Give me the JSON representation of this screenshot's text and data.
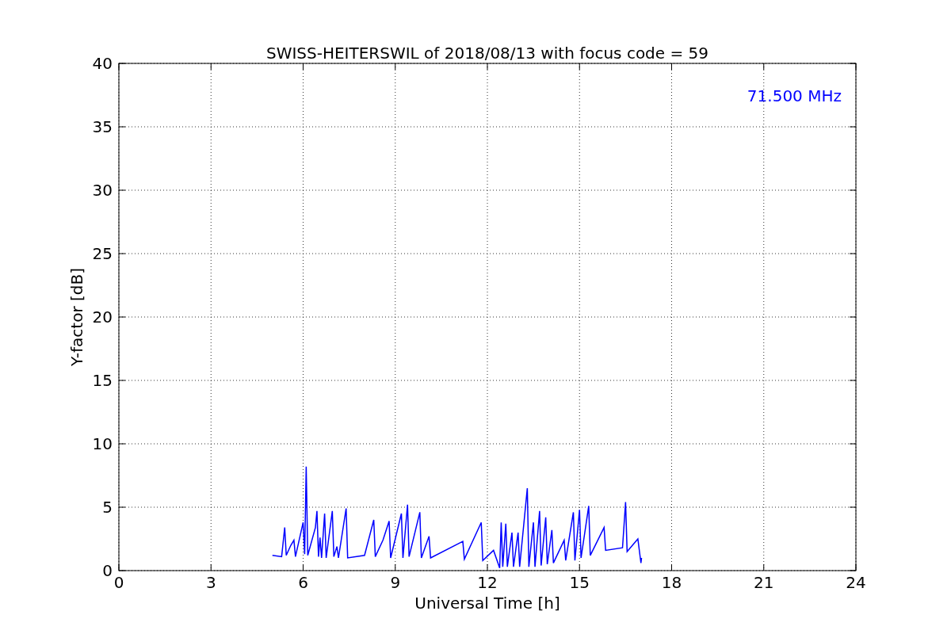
{
  "figure": {
    "chart_data": {
      "type": "line",
      "title": "SWISS-HEITERSWIL of 2018/08/13 with focus code = 59",
      "xlabel": "Universal Time [h]",
      "ylabel": "Y-factor [dB]",
      "xlim": [
        0,
        24
      ],
      "ylim": [
        0,
        40
      ],
      "xticks": [
        0,
        3,
        6,
        9,
        12,
        15,
        18,
        21,
        24
      ],
      "yticks": [
        0,
        5,
        10,
        15,
        20,
        25,
        30,
        35,
        40
      ],
      "x": [
        5.0,
        5.3,
        5.4,
        5.45,
        5.6,
        5.7,
        5.75,
        6.0,
        6.05,
        6.1,
        6.15,
        6.4,
        6.45,
        6.5,
        6.55,
        6.6,
        6.7,
        6.75,
        6.95,
        7.0,
        7.1,
        7.15,
        7.4,
        7.45,
        8.0,
        8.3,
        8.35,
        8.6,
        8.8,
        8.85,
        9.2,
        9.25,
        9.4,
        9.45,
        9.8,
        9.85,
        10.1,
        10.15,
        11.2,
        11.25,
        11.8,
        11.85,
        12.2,
        12.4,
        12.45,
        12.5,
        12.6,
        12.65,
        12.8,
        12.85,
        13.0,
        13.05,
        13.3,
        13.35,
        13.5,
        13.55,
        13.7,
        13.75,
        13.9,
        13.95,
        14.1,
        14.15,
        14.5,
        14.55,
        14.8,
        14.85,
        15.0,
        15.05,
        15.3,
        15.35,
        15.8,
        15.85,
        16.4,
        16.5,
        16.55,
        16.9,
        17.0,
        17.02
      ],
      "series": [
        {
          "name": "71.500 MHz",
          "color": "#0000ff",
          "values": [
            1.2,
            1.1,
            3.4,
            1.2,
            2.0,
            2.4,
            1.1,
            3.8,
            1.3,
            8.2,
            1.2,
            3.4,
            4.7,
            1.1,
            2.6,
            1.0,
            4.5,
            1.0,
            4.7,
            1.1,
            1.9,
            1.0,
            4.9,
            1.0,
            1.2,
            4.0,
            1.1,
            2.4,
            3.9,
            1.0,
            4.5,
            1.0,
            5.2,
            1.1,
            4.6,
            1.0,
            2.7,
            1.0,
            2.3,
            0.9,
            3.8,
            0.8,
            1.6,
            0.2,
            3.8,
            0.3,
            3.7,
            0.3,
            3.0,
            0.3,
            3.0,
            0.3,
            6.5,
            0.3,
            3.8,
            0.3,
            4.7,
            0.4,
            4.2,
            0.5,
            3.2,
            0.6,
            2.4,
            0.8,
            4.6,
            0.8,
            4.8,
            1.0,
            5.1,
            1.2,
            3.4,
            1.6,
            1.8,
            5.4,
            1.5,
            2.5,
            0.6,
            1.0
          ]
        }
      ],
      "grid": true
    }
  }
}
